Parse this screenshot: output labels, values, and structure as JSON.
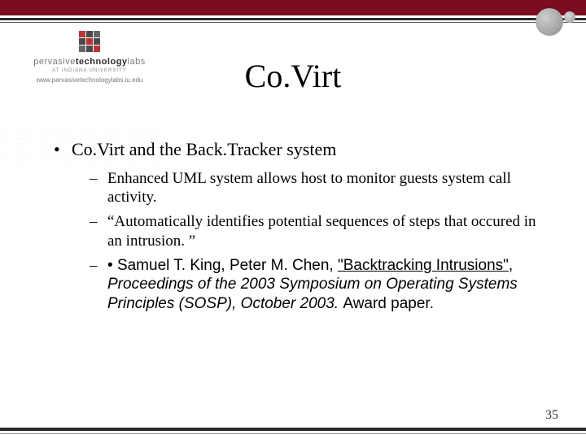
{
  "logo": {
    "line1_a": "pervasive",
    "line1_b": "technology",
    "line1_c": "labs",
    "sub": "AT INDIANA UNIVERSITY",
    "url": "www.pervasivetechnologylabs.iu.edu"
  },
  "title": "Co.Virt",
  "bullets": {
    "l1": "Co.Virt and the Back.Tracker system",
    "l2_1": "Enhanced UML system allows host to monitor guests system call activity.",
    "l2_2": "“Automatically identifies potential sequences of steps that occured in an intrusion. ”",
    "l2_3_bullet": "• ",
    "l2_3_authors": "Samuel T. King, Peter M. Chen, ",
    "l2_3_title": "\"Backtracking Intrusions\"",
    "l2_3_comma": ", ",
    "l2_3_proc": "Proceedings of the 2003 Symposium on Operating Systems Principles ",
    "l2_3_tail": " (SOSP), October 2003. ",
    "l2_3_award": "Award paper."
  },
  "page": "35"
}
